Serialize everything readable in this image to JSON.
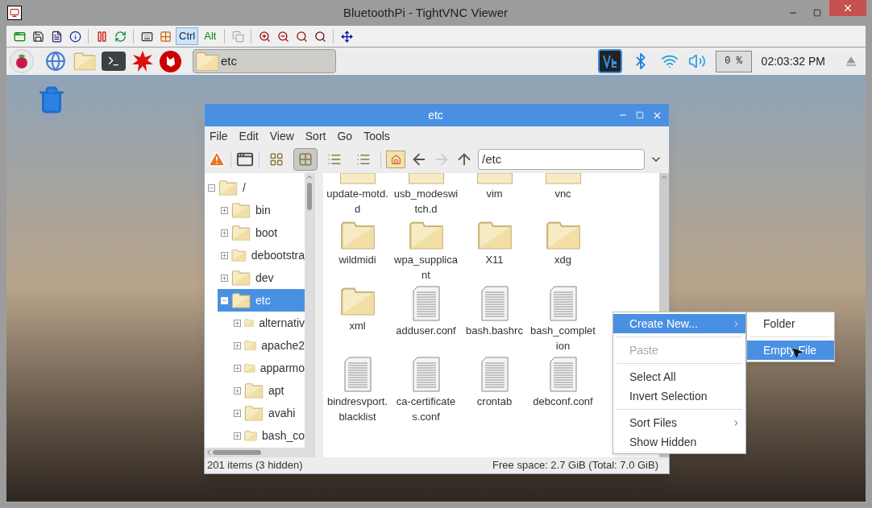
{
  "window": {
    "title": "BluetoothPi - TightVNC Viewer"
  },
  "vnc_toolbar": {
    "keys": [
      {
        "label": "Ctrl",
        "selected": true
      },
      {
        "label": "Alt",
        "selected": false
      }
    ]
  },
  "panel": {
    "task": {
      "label": "etc"
    },
    "cpu": "0 %",
    "clock": "02:03:32 PM"
  },
  "file_manager": {
    "title": "etc",
    "menu": [
      "File",
      "Edit",
      "View",
      "Sort",
      "Go",
      "Tools"
    ],
    "view_modes": [
      {
        "selected": false
      },
      {
        "selected": true
      },
      {
        "selected": false
      },
      {
        "selected": false
      }
    ],
    "path": "/etc",
    "tree": [
      {
        "label": "/",
        "expanded": true,
        "selected": false,
        "children": [
          {
            "label": "bin",
            "expanded": false,
            "selected": false
          },
          {
            "label": "boot",
            "expanded": false,
            "selected": false
          },
          {
            "label": "debootstra",
            "expanded": false,
            "selected": false
          },
          {
            "label": "dev",
            "expanded": false,
            "selected": false
          },
          {
            "label": "etc",
            "expanded": true,
            "selected": true,
            "children": [
              {
                "label": "alternativ",
                "expanded": false,
                "selected": false
              },
              {
                "label": "apache2",
                "expanded": false,
                "selected": false
              },
              {
                "label": "apparmo",
                "expanded": false,
                "selected": false
              },
              {
                "label": "apt",
                "expanded": false,
                "selected": false
              },
              {
                "label": "avahi",
                "expanded": false,
                "selected": false
              },
              {
                "label": "bash_co",
                "expanded": false,
                "selected": false
              }
            ]
          }
        ]
      }
    ],
    "files": [
      {
        "name": "update-motd.d",
        "kind": "folder",
        "partial": true
      },
      {
        "name": "usb_modeswitch.d",
        "kind": "folder",
        "partial": true
      },
      {
        "name": "vim",
        "kind": "folder",
        "partial": true
      },
      {
        "name": "vnc",
        "kind": "folder",
        "partial": true
      },
      {
        "name": "wildmidi",
        "kind": "folder",
        "partial": false
      },
      {
        "name": "wpa_supplicant",
        "kind": "folder",
        "partial": false
      },
      {
        "name": "X11",
        "kind": "folder",
        "partial": false
      },
      {
        "name": "xdg",
        "kind": "folder",
        "partial": false
      },
      {
        "name": "xml",
        "kind": "folder",
        "partial": false
      },
      {
        "name": "adduser.conf",
        "kind": "file",
        "partial": false
      },
      {
        "name": "bash.bashrc",
        "kind": "file",
        "partial": false
      },
      {
        "name": "bash_completion",
        "kind": "file",
        "partial": false
      },
      {
        "name": "bindresvport.blacklist",
        "kind": "file",
        "partial": false
      },
      {
        "name": "ca-certificates.conf",
        "kind": "file",
        "partial": false
      },
      {
        "name": "crontab",
        "kind": "file",
        "partial": false
      },
      {
        "name": "debconf.conf",
        "kind": "file",
        "partial": false
      }
    ],
    "status_left": "201 items (3 hidden)",
    "status_right": "Free space: 2.7 GiB (Total: 7.0 GiB)"
  },
  "context_menu": {
    "items": [
      {
        "kind": "item",
        "label": "Create New...",
        "selected": true,
        "disabled": false,
        "submenu": true
      },
      {
        "kind": "separator"
      },
      {
        "kind": "item",
        "label": "Paste",
        "selected": false,
        "disabled": true,
        "submenu": false
      },
      {
        "kind": "separator"
      },
      {
        "kind": "item",
        "label": "Select All",
        "selected": false,
        "disabled": false,
        "submenu": false
      },
      {
        "kind": "item",
        "label": "Invert Selection",
        "selected": false,
        "disabled": false,
        "submenu": false
      },
      {
        "kind": "separator"
      },
      {
        "kind": "item",
        "label": "Sort Files",
        "selected": false,
        "disabled": false,
        "submenu": true
      },
      {
        "kind": "item",
        "label": "Show Hidden",
        "selected": false,
        "disabled": false,
        "submenu": false
      }
    ],
    "submenu": [
      {
        "kind": "item",
        "label": "Folder",
        "selected": false
      },
      {
        "kind": "separator"
      },
      {
        "kind": "item",
        "label": "Empty File",
        "selected": true
      }
    ]
  }
}
